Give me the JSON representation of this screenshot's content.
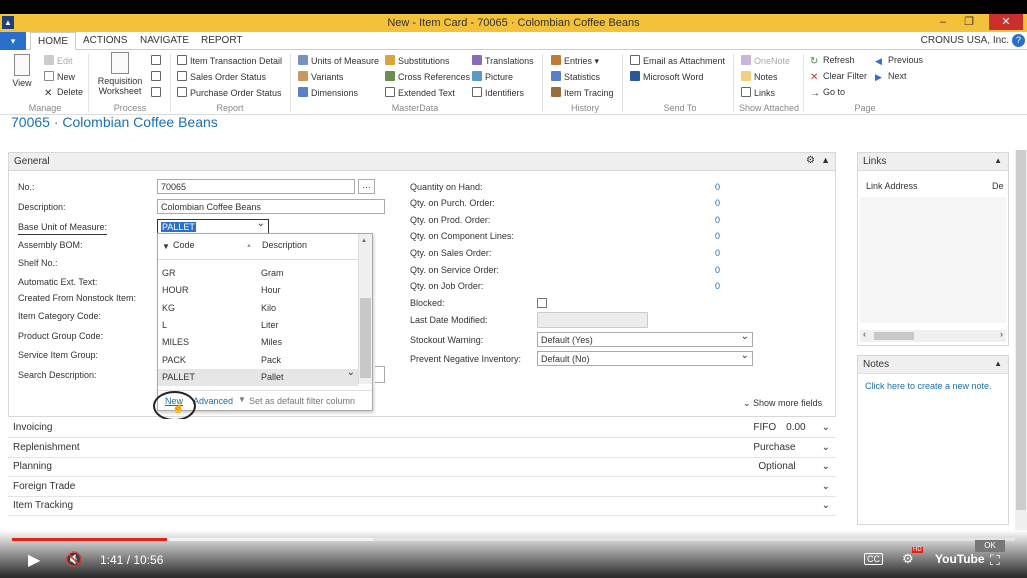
{
  "window": {
    "title": "New - Item Card - 70065 · Colombian Coffee Beans",
    "logo": "NAV"
  },
  "ribbon_tabs": [
    "HOME",
    "ACTIONS",
    "NAVIGATE",
    "REPORT"
  ],
  "company": "CRONUS USA, Inc.",
  "ribbon": {
    "manage": {
      "label": "Manage",
      "view": "View",
      "edit": "Edit",
      "new": "New",
      "delete": "Delete"
    },
    "process": {
      "label": "Process",
      "requisition": "Requisition",
      "worksheet": "Worksheet"
    },
    "report": {
      "label": "Report",
      "items": [
        "Item Transaction Detail",
        "Sales Order Status",
        "Purchase Order Status"
      ]
    },
    "masterdata": {
      "label": "MasterData",
      "col1": [
        "Units of Measure",
        "Variants",
        "Dimensions"
      ],
      "col2": [
        "Substitutions",
        "Cross References",
        "Extended Text"
      ],
      "col3": [
        "Translations",
        "Picture",
        "Identifiers"
      ]
    },
    "history": {
      "label": "History",
      "items": [
        "Entries ▾",
        "Statistics",
        "Item Tracing"
      ]
    },
    "sendto": {
      "label": "Send To",
      "items": [
        "Email as Attachment",
        "Microsoft Word"
      ]
    },
    "attached": {
      "label": "Show Attached",
      "items": [
        "OneNote",
        "Notes",
        "Links"
      ]
    },
    "page": {
      "label": "Page",
      "col1": [
        "Refresh",
        "Clear Filter",
        "Go to"
      ],
      "col2": [
        "Previous",
        "Next"
      ]
    }
  },
  "page_title": "70065 · Colombian Coffee Beans",
  "general": {
    "header": "General",
    "left_labels": [
      "No.:",
      "Description:",
      "Base Unit of Measure:",
      "Assembly BOM:",
      "Shelf No.:",
      "Automatic Ext. Text:",
      "Created From Nonstock Item:",
      "Item Category Code:",
      "Product Group Code:",
      "Service Item Group:",
      "Search Description:"
    ],
    "no_value": "70065",
    "description_value": "Colombian Coffee Beans",
    "base_uom_value": "PALLET",
    "right_labels": [
      "Quantity on Hand:",
      "Qty. on Purch. Order:",
      "Qty. on Prod. Order:",
      "Qty. on Component Lines:",
      "Qty. on Sales Order:",
      "Qty. on Service Order:",
      "Qty. on Job Order:"
    ],
    "right_values": [
      "0",
      "0",
      "0",
      "0",
      "0",
      "0",
      "0"
    ],
    "blocked_label": "Blocked:",
    "last_modified_label": "Last Date Modified:",
    "stockout_label": "Stockout Warning:",
    "stockout_value": "Default (Yes)",
    "prevent_label": "Prevent Negative Inventory:",
    "prevent_value": "Default (No)",
    "show_more": "Show more fields"
  },
  "dropdown": {
    "col_code": "Code",
    "col_desc": "Description",
    "rows": [
      {
        "code": "GR",
        "desc": "Gram"
      },
      {
        "code": "HOUR",
        "desc": "Hour"
      },
      {
        "code": "KG",
        "desc": "Kilo"
      },
      {
        "code": "L",
        "desc": "Liter"
      },
      {
        "code": "MILES",
        "desc": "Miles"
      },
      {
        "code": "PACK",
        "desc": "Pack"
      },
      {
        "code": "PALLET",
        "desc": "Pallet"
      }
    ],
    "new": "New",
    "advanced": "Advanced",
    "set_default": "Set as default filter column"
  },
  "collapsed_tabs": [
    {
      "label": "Invoicing",
      "right": "FIFO",
      "right2": "0.00"
    },
    {
      "label": "Replenishment",
      "right": "Purchase",
      "right2": ""
    },
    {
      "label": "Planning",
      "right": "Optional",
      "right2": ""
    },
    {
      "label": "Foreign Trade",
      "right": "",
      "right2": ""
    },
    {
      "label": "Item Tracking",
      "right": "",
      "right2": ""
    }
  ],
  "links_panel": {
    "header": "Links",
    "col": "Link Address",
    "col2": "De"
  },
  "notes_panel": {
    "header": "Notes",
    "link": "Click here to create a new note."
  },
  "player": {
    "time": "1:41 / 10:56",
    "progress_fraction": 0.155,
    "buffered_fraction": 0.36,
    "badge": "HD",
    "brand": "YouTube",
    "cc": "CC",
    "ok": "OK"
  }
}
